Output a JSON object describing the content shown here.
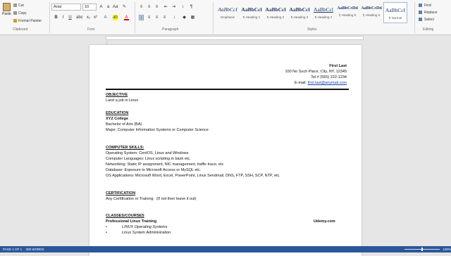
{
  "ribbon": {
    "clipboard": {
      "paste": "Paste",
      "cut": "Cut",
      "copy": "Copy",
      "format_painter": "Format Painter",
      "label": "Clipboard"
    },
    "font": {
      "name": "Arial",
      "size": "10",
      "label": "Font",
      "bold": "B",
      "italic": "I",
      "underline": "U"
    },
    "paragraph": {
      "label": "Paragraph"
    },
    "styles": {
      "label": "Styles",
      "items": [
        {
          "sample": "AaBbCcI",
          "name": "Emphasis"
        },
        {
          "sample": "AaBbCcl",
          "name": "¶ Heading 1"
        },
        {
          "sample": "AaBbCcl",
          "name": "¶ Heading 2"
        },
        {
          "sample": "AaBbCcl",
          "name": "¶ Heading 3"
        },
        {
          "sample": "AaBbCcl",
          "name": "¶ Heading 4"
        },
        {
          "sample": "AaBbCcDd",
          "name": "¶ Heading 5"
        },
        {
          "sample": "AaBbCcDd",
          "name": "¶ Heading 6"
        },
        {
          "sample": "AaBbCcI",
          "name": "¶ Normal"
        }
      ]
    },
    "editing": {
      "find": "Find",
      "replace": "Replace",
      "select": "Select",
      "label": "Editing"
    }
  },
  "document": {
    "name": "First Last",
    "address": "100 No Such Place, City, NY, 12345",
    "tel": "Tel # (555) 222-1234",
    "email_label": "E-mail:",
    "email": "first.last@anymail.com",
    "objective_heading": "OBJECTIVE",
    "objective": "Land a job in Linux",
    "education_heading": "EDUCATION",
    "college": "XYZ College",
    "degree": "Bachelor of Arts (BA)",
    "major": "Major: Computer Information Systems or Computer Science",
    "skills_heading": "COMPUTER SKILLS:",
    "skills": [
      {
        "k": "Operating System",
        "v": ": CentOS, Linux and Windows"
      },
      {
        "k": "Computer Languages",
        "v": ": Linux scripting in bash etc."
      },
      {
        "k": "Networking",
        "v": ": Static IP assignment, NIC management, traffic trace, etc"
      },
      {
        "k": "Database",
        "v": ": Exposure to Microsoft Access or MySQL etc."
      },
      {
        "k": "OS Applications",
        "v": ": Microsoft Word, Excel, PowerPoint, Linux Sendmail, DNS, FTP, SSH, SCP, NTP, etc."
      }
    ],
    "cert_heading": "CERTIFICATION",
    "cert": "Any Certification or Training",
    "cert_note": "(If not then leave it out)",
    "classes_heading": "CLASSES/COURSES",
    "training": "Professional Linux Training",
    "provider": "Udemy.com",
    "courses": [
      "LINUX Operating Systems",
      "Linux System Administration"
    ]
  },
  "status": {
    "page": "PAGE 1 OF 1",
    "words": "309 WORDS",
    "zoom": "100%"
  }
}
